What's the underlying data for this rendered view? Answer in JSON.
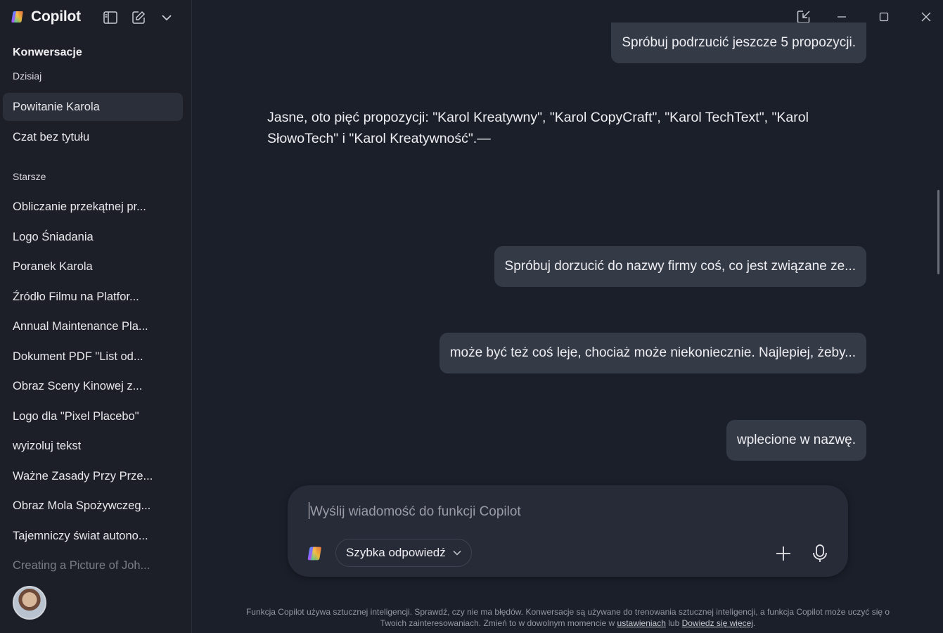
{
  "app": {
    "name": "Copilot"
  },
  "sidebar": {
    "section_title": "Konwersacje",
    "today_label": "Dzisiaj",
    "today_items": [
      "Powitanie Karola",
      "Czat bez tytułu"
    ],
    "older_label": "Starsze",
    "older_items": [
      "Obliczanie przekątnej pr...",
      "Logo Śniadania",
      "Poranek Karola",
      "Źródło Filmu na Platfor...",
      "Annual Maintenance Pla...",
      "Dokument PDF \"List od...",
      "Obraz Sceny Kinowej z...",
      "Logo dla \"Pixel Placebo\"",
      "wyizoluj tekst",
      "Ważne Zasady Przy Prze...",
      "Obraz Mola Spożywczeg...",
      "Tajemniczy świat autono...",
      "Creating a Picture of Joh..."
    ]
  },
  "messages": {
    "user_1": "Spróbuj podrzucić jeszcze 5 propozycji.",
    "assistant_1": "Jasne, oto pięć propozycji: \"Karol Kreatywny\", \"Karol CopyCraft\", \"Karol TechText\", \"Karol SłowoTech\" i \"Karol Kreatywność\".—",
    "user_2": "Spróbuj dorzucić do nazwy firmy coś, co jest związane ze...",
    "user_3": "może być też coś leje, chociaż może niekoniecznie. Najlepiej, żeby...",
    "user_4": "wplecione w nazwę."
  },
  "composer": {
    "placeholder": "Wyślij wiadomość do funkcji Copilot",
    "value": "",
    "mode_label": "Szybka odpowiedź"
  },
  "footer": {
    "text_1": "Funkcja Copilot używa sztucznej inteligencji. Sprawdź, czy nie ma błędów. Konwersacje są używane do trenowania sztucznej inteligencji, a funkcja Copilot może uczyć się o Twoich zainteresowaniach. Zmień to w dowolnym momencie w ",
    "link_settings": "ustawieniach",
    "text_2": " lub ",
    "link_learn": "Dowiedz się więcej",
    "text_3": "."
  },
  "colors": {
    "background": "#1b1f2a",
    "sidebar": "#1c1f27",
    "bubble": "#353a47",
    "composer": "#272b37"
  },
  "icons": [
    "copilot-logo-icon",
    "sidebar-toggle-icon",
    "new-chat-icon",
    "chevron-down-icon",
    "pop-out-icon",
    "minimize-icon",
    "maximize-icon",
    "close-icon",
    "plus-icon",
    "microphone-icon"
  ]
}
